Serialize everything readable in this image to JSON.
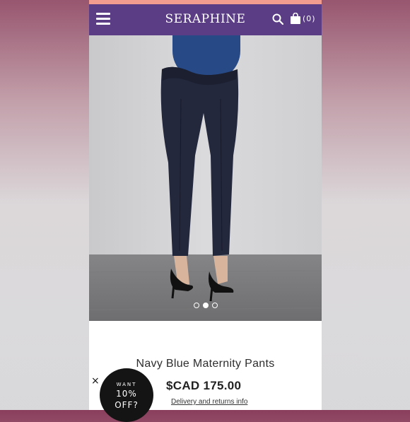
{
  "header": {
    "brand": "SERAPHINE",
    "cart_count": "(0)",
    "colors": {
      "header_bg": "#5b3d86",
      "top_strip": "#f29c8f"
    },
    "icons": [
      "menu-icon",
      "search-icon",
      "shopping-bag-icon"
    ]
  },
  "gallery": {
    "image_alt": "Navy Blue Maternity Pants",
    "dots": 3,
    "active_dot": 2
  },
  "product": {
    "title": "Navy Blue Maternity Pants",
    "price": "$CAD 175.00",
    "delivery_link": "Delivery and returns info"
  },
  "promo": {
    "close_label": "×",
    "line1": "WANT",
    "line2": "10%",
    "line3": "OFF?"
  }
}
